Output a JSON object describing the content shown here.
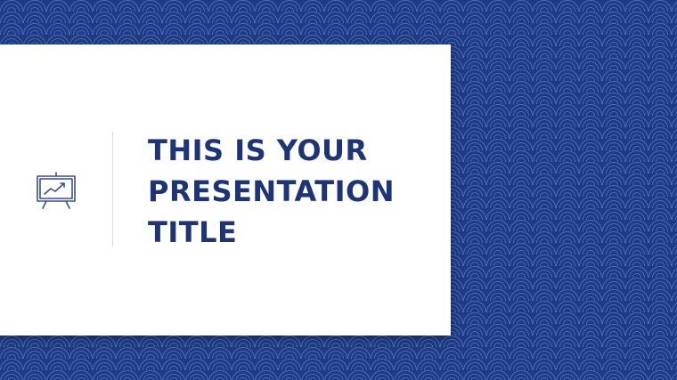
{
  "slide": {
    "title": "THIS IS YOUR\nPRESENTATION\nTITLE",
    "icon": "presentation-board-chart-icon"
  },
  "colors": {
    "background": "#1f3b86",
    "card": "#ffffff",
    "title_text": "#1d3576",
    "icon_stroke": "#3a4f8a",
    "divider": "#e0e0e0"
  }
}
